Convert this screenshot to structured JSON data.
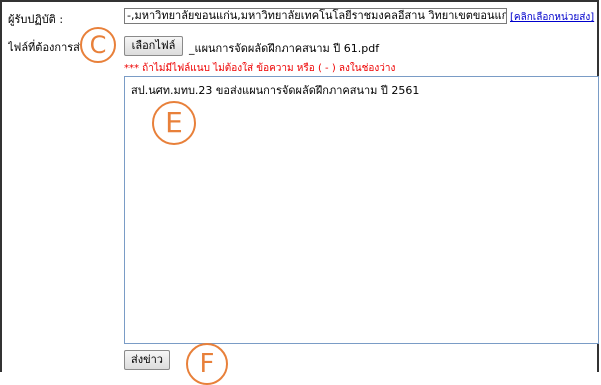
{
  "form": {
    "recipient_label": "ผู้รับปฏิบัติ :",
    "recipient_value": "-,มหาวิทยาลัยขอนแก่น,มหาวิทยาลัยเทคโนโลยีราชมงคลอีสาน วิทยาเขตขอนแก่น,;",
    "pick_units_link": "[คลิกเลือกหน่วยส่ง]",
    "file_label": "ไฟล์ที่ต้องการส่ง :",
    "file_button": "เลือกไฟล์",
    "file_name": "_แผนการจัดผลัดฝึกภาคสนาม ปี 61.pdf",
    "warning_text": "*** ถ้าไม่มีไฟล์แนบ ไม่ต้องใส่ ข้อความ หรือ ( - ) ลงในช่องว่าง",
    "message_text": "สป.นศท.มทบ.23 ขอส่งแผนการจัดผลัดฝึกภาคสนาม ปี 2561",
    "send_button": "ส่งข่าว"
  },
  "annotations": {
    "c": "C",
    "e": "E",
    "f": "F"
  },
  "colors": {
    "callout": "#e8803a",
    "warning": "#ee0000",
    "link": "#0000cc"
  }
}
